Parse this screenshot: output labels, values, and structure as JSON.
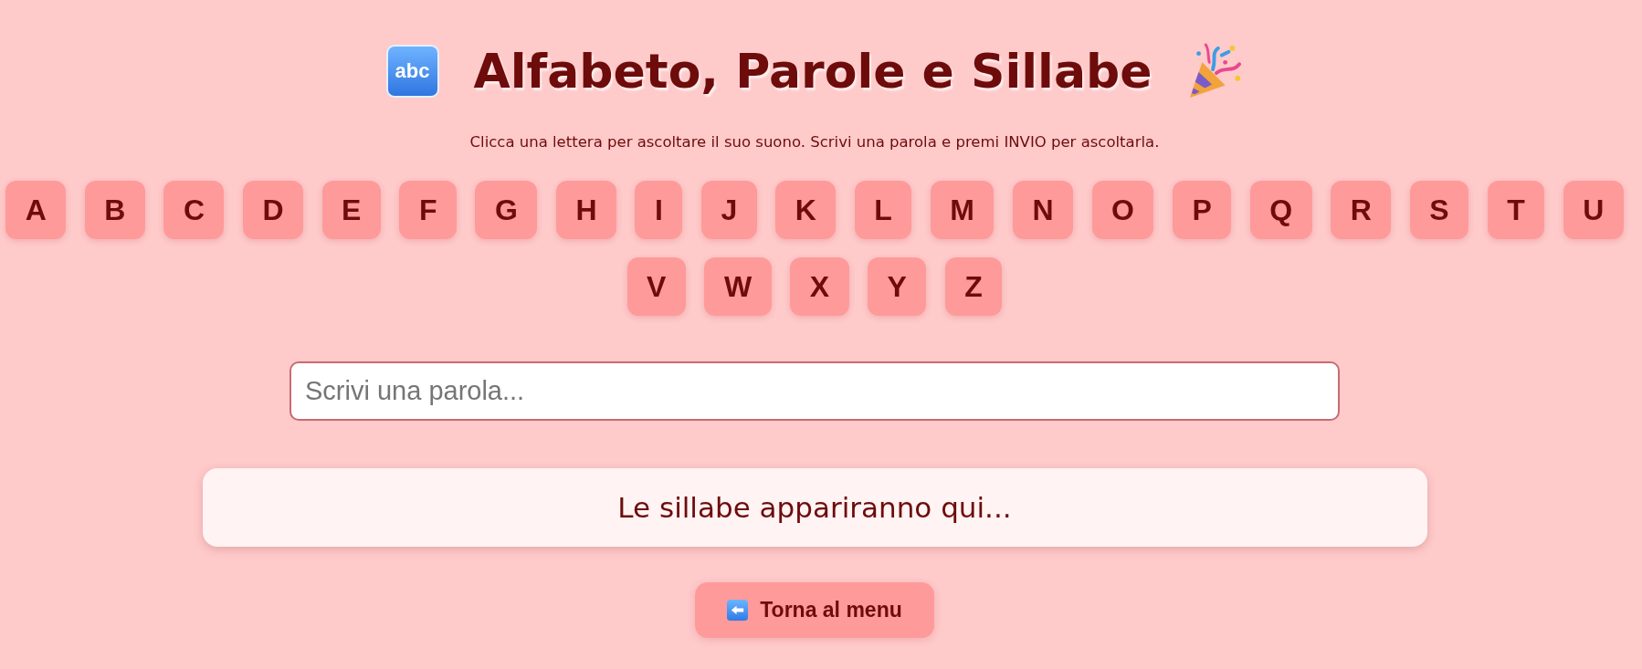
{
  "header": {
    "emoji_label": "abc",
    "title": "Alfabeto, Parole e Sillabe"
  },
  "instructions": "Clicca una lettera per ascoltare il suo suono. Scrivi una parola e premi INVIO per ascoltarla.",
  "letters": [
    "A",
    "B",
    "C",
    "D",
    "E",
    "F",
    "G",
    "H",
    "I",
    "J",
    "K",
    "L",
    "M",
    "N",
    "O",
    "P",
    "Q",
    "R",
    "S",
    "T",
    "U",
    "V",
    "W",
    "X",
    "Y",
    "Z"
  ],
  "word_input": {
    "placeholder": "Scrivi una parola..."
  },
  "syllables_box": {
    "text": "Le sillabe appariranno qui..."
  },
  "back_button": {
    "label": "Torna al menu"
  }
}
